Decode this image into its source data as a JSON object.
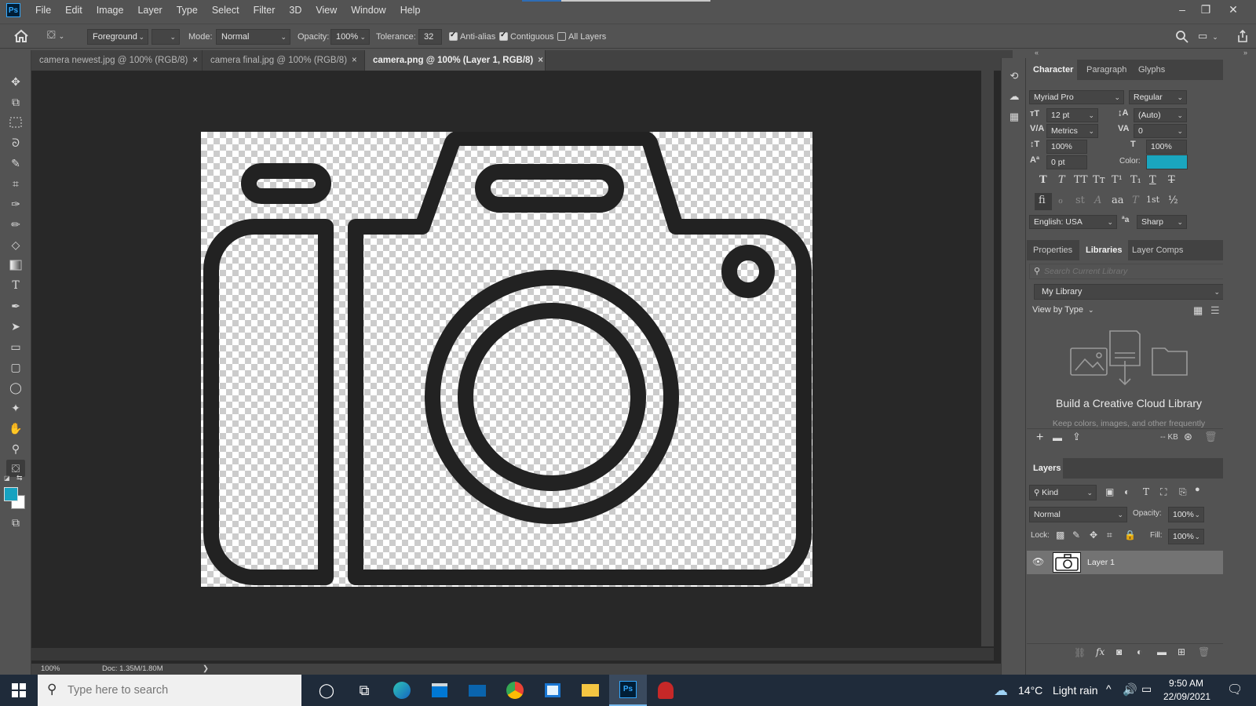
{
  "app": {
    "logo": "Ps",
    "menus": [
      "File",
      "Edit",
      "Image",
      "Layer",
      "Type",
      "Select",
      "Filter",
      "3D",
      "View",
      "Window",
      "Help"
    ],
    "window_controls": [
      "minimize-icon",
      "restore-icon",
      "close-icon"
    ]
  },
  "options": {
    "fill_source": "Foreground",
    "mode_label": "Mode:",
    "mode_value": "Normal",
    "opacity_label": "Opacity:",
    "opacity_value": "100%",
    "tolerance_label": "Tolerance:",
    "tolerance_value": "32",
    "anti_alias": {
      "label": "Anti-alias",
      "checked": true
    },
    "contiguous": {
      "label": "Contiguous",
      "checked": true
    },
    "all_layers": {
      "label": "All Layers",
      "checked": false
    }
  },
  "tabs": [
    {
      "label": "camera newest.jpg @ 100% (RGB/8)",
      "active": false
    },
    {
      "label": "camera final.jpg @ 100% (RGB/8)",
      "active": false
    },
    {
      "label": "camera.png @ 100% (Layer 1, RGB/8)",
      "active": true
    }
  ],
  "tab_close": "×",
  "tools": [
    "move-tool-icon",
    "artboard-tool-icon",
    "marquee-tool-icon",
    "lasso-tool-icon",
    "quick-select-tool-icon",
    "crop-tool-icon",
    "eyedropper-tool-icon",
    "brush-tool-icon",
    "eraser-tool-icon",
    "gradient-tool-icon",
    "type-tool-icon",
    "pen-tool-icon",
    "path-select-tool-icon",
    "rectangle-tool-icon",
    "rounded-rectangle-tool-icon",
    "ellipse-tool-icon",
    "custom-shape-tool-icon",
    "hand-tool-icon",
    "zoom-tool-icon",
    "paint-bucket-tool-icon"
  ],
  "colors": {
    "foreground": "#17a2c0",
    "background": "#ffffff",
    "text_color_swatch": "#1aa6bf",
    "camera_stroke": "#222222"
  },
  "status": {
    "zoom": "100%",
    "doc_size": "Doc: 1.35M/1.80M",
    "arrow": "❯"
  },
  "character": {
    "tabs": [
      "Character",
      "Paragraph",
      "Glyphs"
    ],
    "font_family": "Myriad Pro",
    "font_style": "Regular",
    "font_size": "12 pt",
    "leading": "(Auto)",
    "kerning": "Metrics",
    "tracking": "0",
    "vertical_scale": "100%",
    "horizontal_scale": "100%",
    "baseline_shift": "0 pt",
    "color_label": "Color:",
    "language": "English: USA",
    "antialias": "Sharp",
    "type_buttons_row1": [
      "T",
      "T",
      "TT",
      "Tт",
      "T¹",
      "T₁",
      "T",
      "T"
    ],
    "type_buttons_row2": [
      "ﬁ",
      "ℴ",
      "st",
      "A",
      "aa",
      "T",
      "1st",
      "½"
    ]
  },
  "libraries": {
    "tabs": [
      "Properties",
      "Libraries",
      "Layer Comps"
    ],
    "search_placeholder": "Search Current Library",
    "library_name": "My Library",
    "view_by": "View by Type",
    "empty_title": "Build a Creative Cloud Library",
    "empty_subtitle": "Keep colors, images, and other frequently",
    "size_kb": "-- KB"
  },
  "layers": {
    "tab": "Layers",
    "filter_kind": "Kind",
    "blend_mode": "Normal",
    "opacity_label": "Opacity:",
    "opacity_value": "100%",
    "lock_label": "Lock:",
    "fill_label": "Fill:",
    "fill_value": "100%",
    "items": [
      {
        "name": "Layer 1",
        "visible": true,
        "selected": true
      }
    ]
  },
  "taskbar": {
    "search_placeholder": "Type here to search",
    "weather_temp": "14°C",
    "weather_desc": "Light rain",
    "time": "9:50 AM",
    "date": "22/09/2021"
  }
}
